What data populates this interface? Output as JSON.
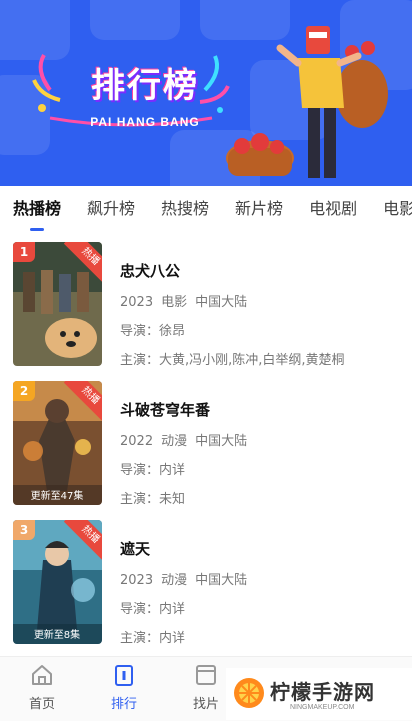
{
  "banner": {
    "title_cn": "排行榜",
    "title_en": "PAI HANG BANG"
  },
  "tabs": [
    {
      "label": "热播榜",
      "active": true
    },
    {
      "label": "飙升榜",
      "active": false
    },
    {
      "label": "热搜榜",
      "active": false
    },
    {
      "label": "新片榜",
      "active": false
    },
    {
      "label": "电视剧",
      "active": false
    },
    {
      "label": "电影",
      "active": false
    }
  ],
  "items": [
    {
      "rank": "1",
      "hot_tag": "热播",
      "title": "忠犬八公",
      "year": "2023",
      "type": "电影",
      "region": "中国大陆",
      "director": "导演：徐昂",
      "cast": "主演：大黄,冯小刚,陈冲,白举纲,黄楚桐",
      "rank_color": "#e8493d",
      "poster_caption": ""
    },
    {
      "rank": "2",
      "hot_tag": "热播",
      "title": "斗破苍穹年番",
      "year": "2022",
      "type": "动漫",
      "region": "中国大陆",
      "director": "导演：内详",
      "cast": "主演：未知",
      "rank_color": "#f5a623",
      "poster_caption": "更新至47集"
    },
    {
      "rank": "3",
      "hot_tag": "热播",
      "title": "遮天",
      "year": "2023",
      "type": "动漫",
      "region": "中国大陆",
      "director": "导演：内详",
      "cast": "主演：内详",
      "rank_color": "#f0a86a",
      "poster_caption": "更新至8集"
    }
  ],
  "nav": {
    "home": "首页",
    "ranking": "排行",
    "find": "找片"
  },
  "watermark": {
    "text": "柠檬手游网",
    "sub": "NINGMAKEUP.COM"
  },
  "colors": {
    "accent": "#2f5ff0",
    "hot": "#e8493d"
  }
}
